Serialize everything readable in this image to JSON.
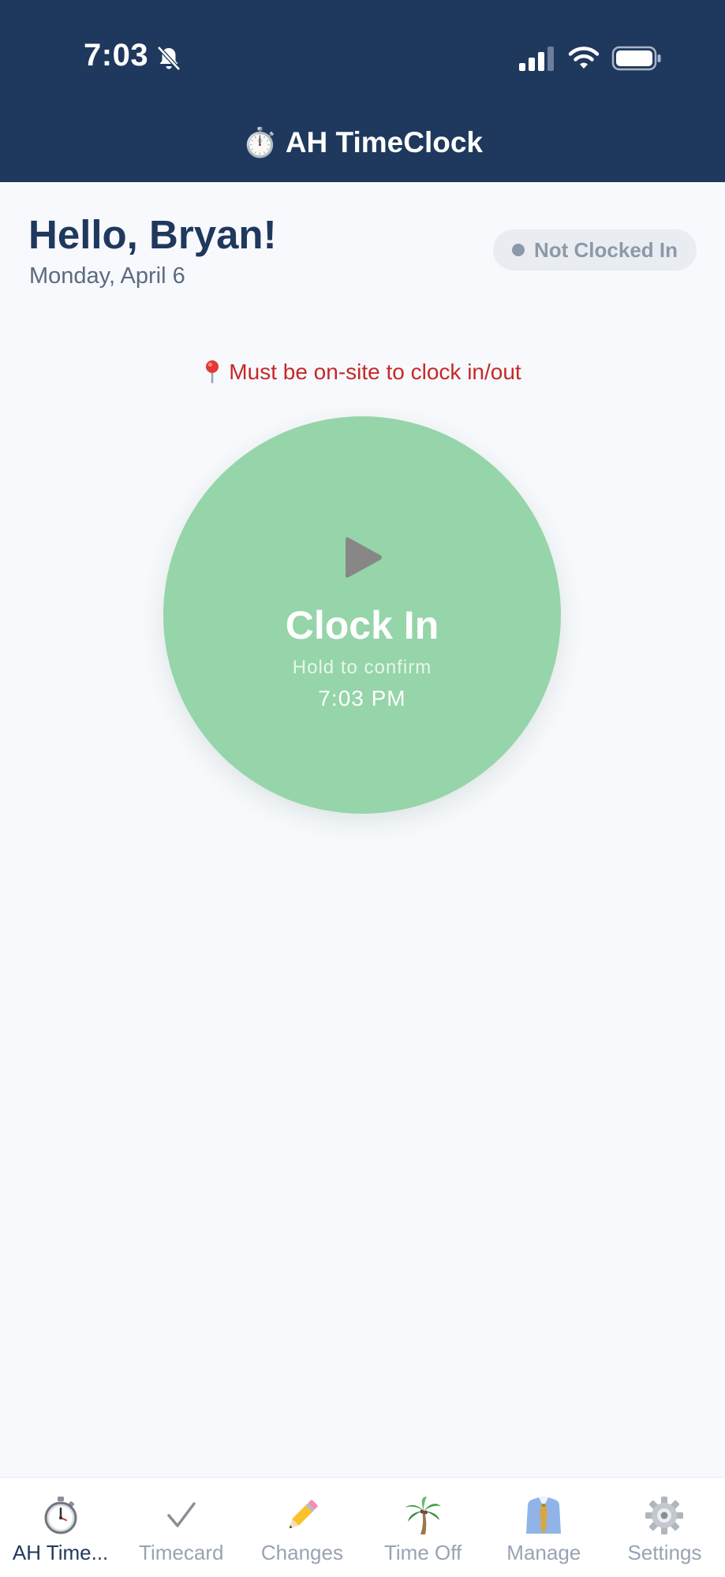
{
  "status_bar": {
    "time": "7:03"
  },
  "header": {
    "title_emoji": "⏱️",
    "title": "AH TimeClock"
  },
  "greeting": {
    "hello": "Hello, Bryan!",
    "date": "Monday, April 6"
  },
  "status_badge": {
    "label": "Not Clocked In"
  },
  "notice": {
    "text": "Must be on-site to clock in/out"
  },
  "clock_button": {
    "label": "Clock In",
    "hint": "Hold to confirm",
    "time": "7:03 PM"
  },
  "tabs": [
    {
      "label": "AH Time...",
      "icon": "stopwatch-icon",
      "active": true
    },
    {
      "label": "Timecard",
      "icon": "checkmark-icon",
      "active": false
    },
    {
      "label": "Changes",
      "icon": "pencil-icon",
      "active": false
    },
    {
      "label": "Time Off",
      "icon": "palm-tree-icon",
      "active": false
    },
    {
      "label": "Manage",
      "icon": "necktie-icon",
      "active": false
    },
    {
      "label": "Settings",
      "icon": "gear-icon",
      "active": false
    }
  ],
  "colors": {
    "header_bg": "#1f385d",
    "button_green": "#95d5a9",
    "notice_red": "#c62828",
    "badge_bg": "#e9edf2"
  }
}
